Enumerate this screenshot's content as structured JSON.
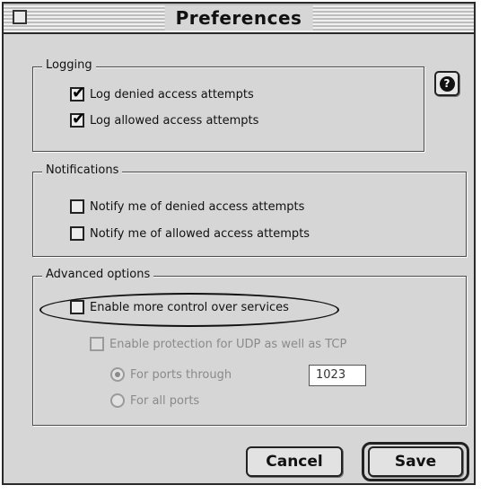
{
  "window": {
    "title": "Preferences"
  },
  "help": {
    "glyph": "?"
  },
  "logging": {
    "label": "Logging",
    "items": [
      {
        "label": "Log denied access attempts",
        "checked": true
      },
      {
        "label": "Log allowed access attempts",
        "checked": true
      }
    ]
  },
  "notifications": {
    "label": "Notifications",
    "items": [
      {
        "label": "Notify me of denied access attempts",
        "checked": false
      },
      {
        "label": "Notify me of allowed access attempts",
        "checked": false
      }
    ]
  },
  "advanced": {
    "label": "Advanced options",
    "enable_control_label": "Enable more control over services",
    "enable_control_checked": false,
    "udp_label": "Enable protection for UDP as well as TCP",
    "udp_checked": false,
    "radio_ports_through_label": "For ports through",
    "radio_all_ports_label": "For all ports",
    "selected_radio": "ports_through",
    "port_value": "1023"
  },
  "buttons": {
    "cancel": "Cancel",
    "save": "Save"
  }
}
